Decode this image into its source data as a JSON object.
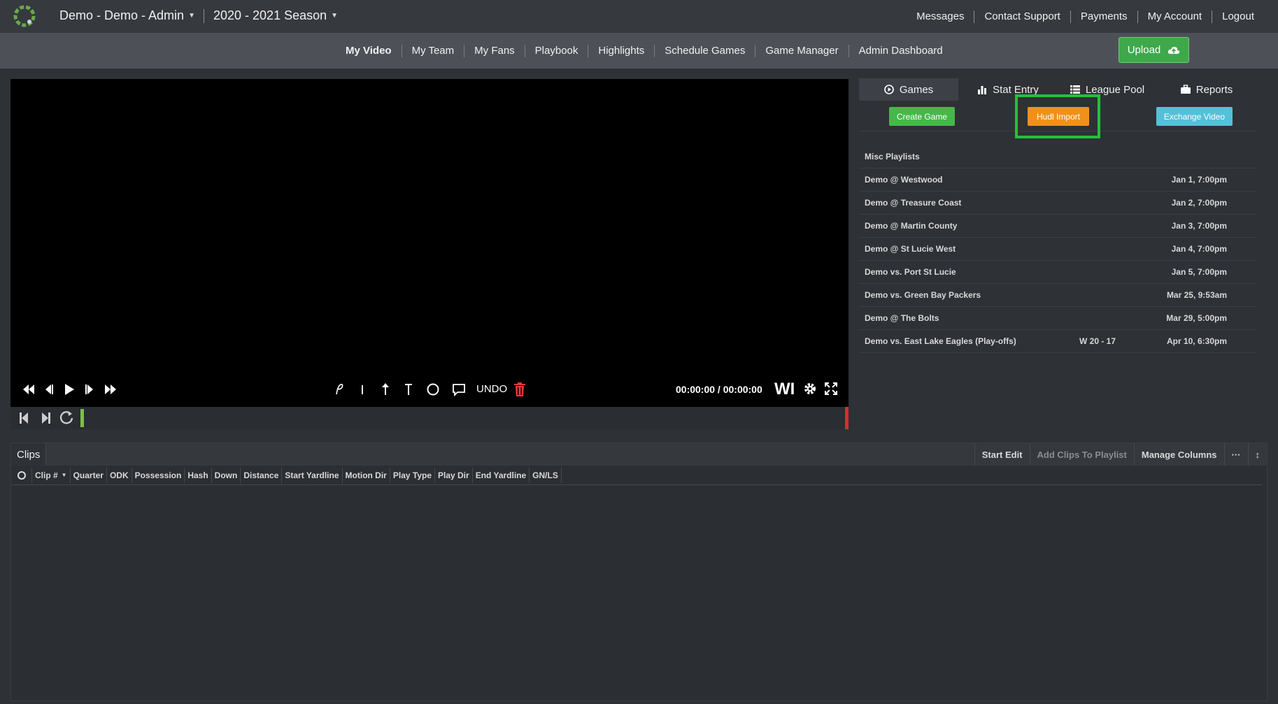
{
  "topbar": {
    "team": "Demo - Demo - Admin",
    "season": "2020 - 2021 Season",
    "links": [
      "Messages",
      "Contact Support",
      "Payments",
      "My Account",
      "Logout"
    ]
  },
  "nav": {
    "items": [
      "My Video",
      "My Team",
      "My Fans",
      "Playbook",
      "Highlights",
      "Schedule Games",
      "Game Manager",
      "Admin Dashboard"
    ],
    "upload_label": "Upload"
  },
  "player": {
    "undo_label": "UNDO",
    "timecode": "00:00:00 / 00:00:00",
    "wi_label": "WI"
  },
  "right_panel": {
    "tabs": [
      "Games",
      "Stat Entry",
      "League Pool",
      "Reports"
    ],
    "buttons": {
      "create": "Create Game",
      "hudl": "Hudl Import",
      "exchange": "Exchange Video"
    },
    "section_title": "Misc Playlists",
    "games": [
      {
        "name": "Demo @ Westwood",
        "result": "",
        "date": "Jan 1, 7:00pm"
      },
      {
        "name": "Demo @ Treasure Coast",
        "result": "",
        "date": "Jan 2, 7:00pm"
      },
      {
        "name": "Demo @ Martin County",
        "result": "",
        "date": "Jan 3, 7:00pm"
      },
      {
        "name": "Demo @ St Lucie West",
        "result": "",
        "date": "Jan 4, 7:00pm"
      },
      {
        "name": "Demo vs. Port St Lucie",
        "result": "",
        "date": "Jan 5, 7:00pm"
      },
      {
        "name": "Demo vs. Green Bay Packers",
        "result": "",
        "date": "Mar 25, 9:53am"
      },
      {
        "name": "Demo @ The Bolts",
        "result": "",
        "date": "Mar 29, 5:00pm"
      },
      {
        "name": "Demo vs. East Lake Eagles (Play-offs)",
        "result": "W 20 - 17",
        "date": "Apr 10, 6:30pm"
      }
    ]
  },
  "clips": {
    "tab": "Clips",
    "actions": [
      "Start Edit",
      "Add Clips To Playlist",
      "Manage Columns",
      "···",
      "↕"
    ],
    "columns": [
      "Clip #",
      "Quarter",
      "ODK",
      "Possession",
      "Hash",
      "Down",
      "Distance",
      "Start Yardline",
      "Motion Dir",
      "Play Type",
      "Play Dir",
      "End Yardline",
      "GN/LS"
    ]
  },
  "colors": {
    "accent_green": "#46b84a",
    "hudl_orange": "#f0911c",
    "exchange_blue": "#55c0d8",
    "highlight_green": "#21c23a"
  }
}
